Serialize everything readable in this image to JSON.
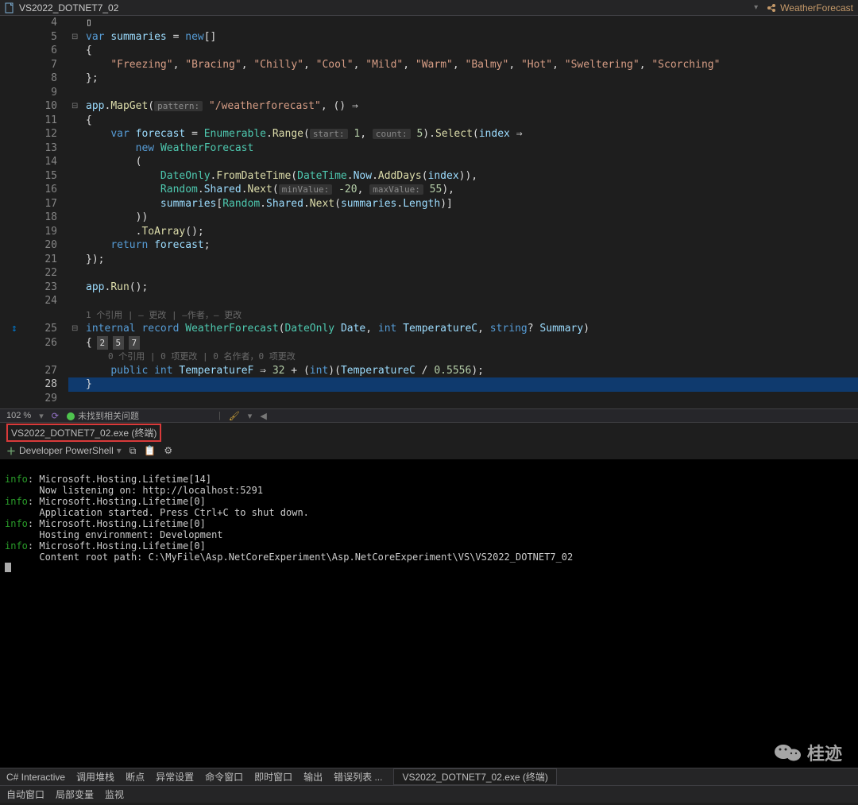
{
  "topbar": {
    "doc_label": "VS2022_DOTNET7_02",
    "type_label": "WeatherForecast"
  },
  "editor": {
    "line_numbers": [
      "4",
      "5",
      "6",
      "7",
      "8",
      "9",
      "10",
      "11",
      "12",
      "13",
      "14",
      "15",
      "16",
      "17",
      "18",
      "19",
      "20",
      "21",
      "22",
      "23",
      "24",
      "25",
      "26",
      "27",
      "28",
      "29"
    ],
    "current_line": "28",
    "codelens1": "1 个引用 | – 更改 | –作者，– 更改",
    "codelens2": "0 个引用 | 0 项更改 | 0 名作者，0 项更改",
    "chips": [
      "2",
      "5",
      "7"
    ],
    "hints": {
      "pattern": "pattern:",
      "start": "start:",
      "count": "count:",
      "minValue": "minValue:",
      "maxValue": "maxValue:"
    },
    "strings": {
      "freezing": "\"Freezing\"",
      "bracing": "\"Bracing\"",
      "chilly": "\"Chilly\"",
      "cool": "\"Cool\"",
      "mild": "\"Mild\"",
      "warm": "\"Warm\"",
      "balmy": "\"Balmy\"",
      "hot": "\"Hot\"",
      "sweltering": "\"Sweltering\"",
      "scorching": "\"Scorching\"",
      "route": "\"/weatherforecast\""
    },
    "tokens": {
      "var": "var",
      "summaries": "summaries",
      "new": "new",
      "app": "app",
      "MapGet": "MapGet",
      "forecast": "forecast",
      "Enumerable": "Enumerable",
      "Range": "Range",
      "Select": "Select",
      "index": "index",
      "WeatherForecast": "WeatherForecast",
      "DateOnly": "DateOnly",
      "FromDateTime": "FromDateTime",
      "DateTime": "DateTime",
      "Now": "Now",
      "AddDays": "AddDays",
      "Random": "Random",
      "Shared": "Shared",
      "Next": "Next",
      "Length": "Length",
      "ToArray": "ToArray",
      "return": "return",
      "Run": "Run",
      "internal": "internal",
      "record": "record",
      "Date": "Date",
      "int": "int",
      "TemperatureC": "TemperatureC",
      "string": "string",
      "Summary": "Summary",
      "public": "public",
      "TemperatureF": "TemperatureF"
    },
    "nums": {
      "one": "1",
      "five": "5",
      "nTwenty": "-20",
      "fiftyFive": "55",
      "thirtyTwo": "32",
      "decim": "0.5556"
    }
  },
  "statusbar": {
    "zoom": "102 %",
    "issues": "未找到相关问题"
  },
  "terminal": {
    "tab_title": "VS2022_DOTNET7_02.exe (终端)",
    "shell_label": "Developer PowerShell",
    "info": "info",
    "lines": {
      "l1": "Microsoft.Hosting.Lifetime[14]",
      "l2": "      Now listening on: http://localhost:5291",
      "l3": "Microsoft.Hosting.Lifetime[0]",
      "l4": "      Application started. Press Ctrl+C to shut down.",
      "l5": "Microsoft.Hosting.Lifetime[0]",
      "l6": "      Hosting environment: Development",
      "l7": "Microsoft.Hosting.Lifetime[0]",
      "l8": "      Content root path: C:\\MyFile\\Asp.NetCoreExperiment\\Asp.NetCoreExperiment\\VS\\VS2022_DOTNET7_02"
    }
  },
  "bottom_tabs": {
    "t0": "C# Interactive",
    "t1": "调用堆栈",
    "t2": "断点",
    "t3": "异常设置",
    "t4": "命令窗口",
    "t5": "即时窗口",
    "t6": "输出",
    "t7": "错误列表 ...",
    "t8": "VS2022_DOTNET7_02.exe (终端)"
  },
  "bottom_tabs2": {
    "t0": "自动窗口",
    "t1": "局部变量",
    "t2": "监视"
  },
  "watermark": "桂迹"
}
